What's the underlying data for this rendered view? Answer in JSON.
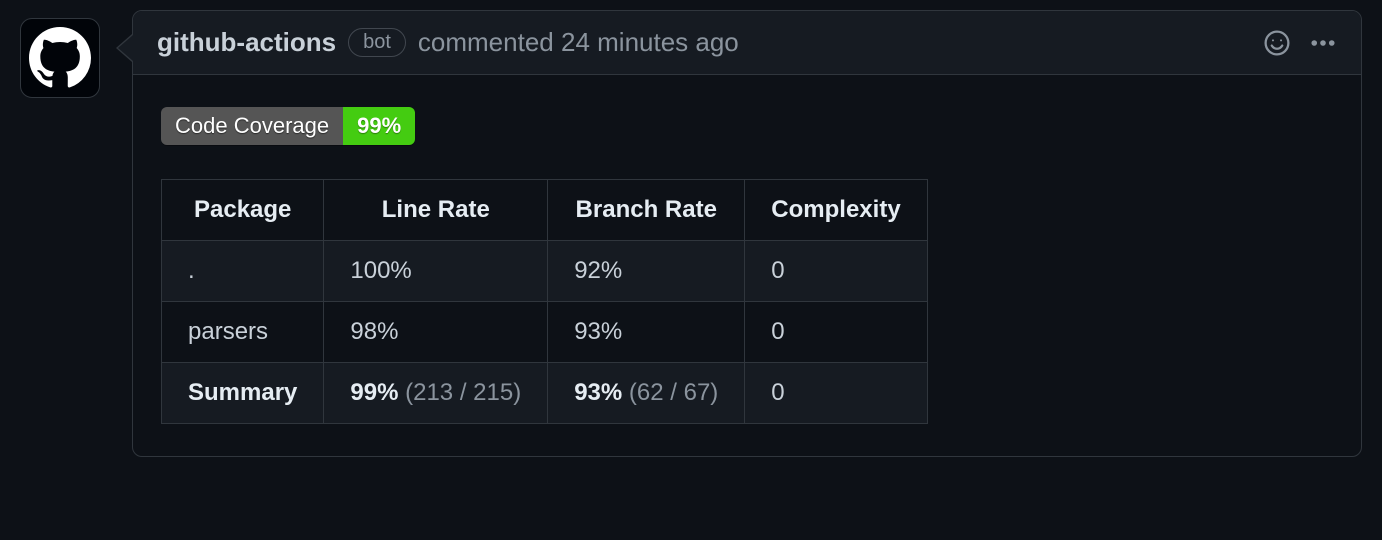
{
  "comment": {
    "author": "github-actions",
    "bot_label": "bot",
    "action_text": "commented",
    "timestamp": "24 minutes ago"
  },
  "badge": {
    "label": "Code Coverage",
    "value": "99%"
  },
  "table": {
    "headers": {
      "package": "Package",
      "line_rate": "Line Rate",
      "branch_rate": "Branch Rate",
      "complexity": "Complexity"
    },
    "rows": [
      {
        "package": ".",
        "line_rate": "100%",
        "branch_rate": "92%",
        "complexity": "0"
      },
      {
        "package": "parsers",
        "line_rate": "98%",
        "branch_rate": "93%",
        "complexity": "0"
      }
    ],
    "summary": {
      "label": "Summary",
      "line_rate_pct": "99%",
      "line_rate_detail": "(213 / 215)",
      "branch_rate_pct": "93%",
      "branch_rate_detail": "(62 / 67)",
      "complexity": "0"
    }
  }
}
